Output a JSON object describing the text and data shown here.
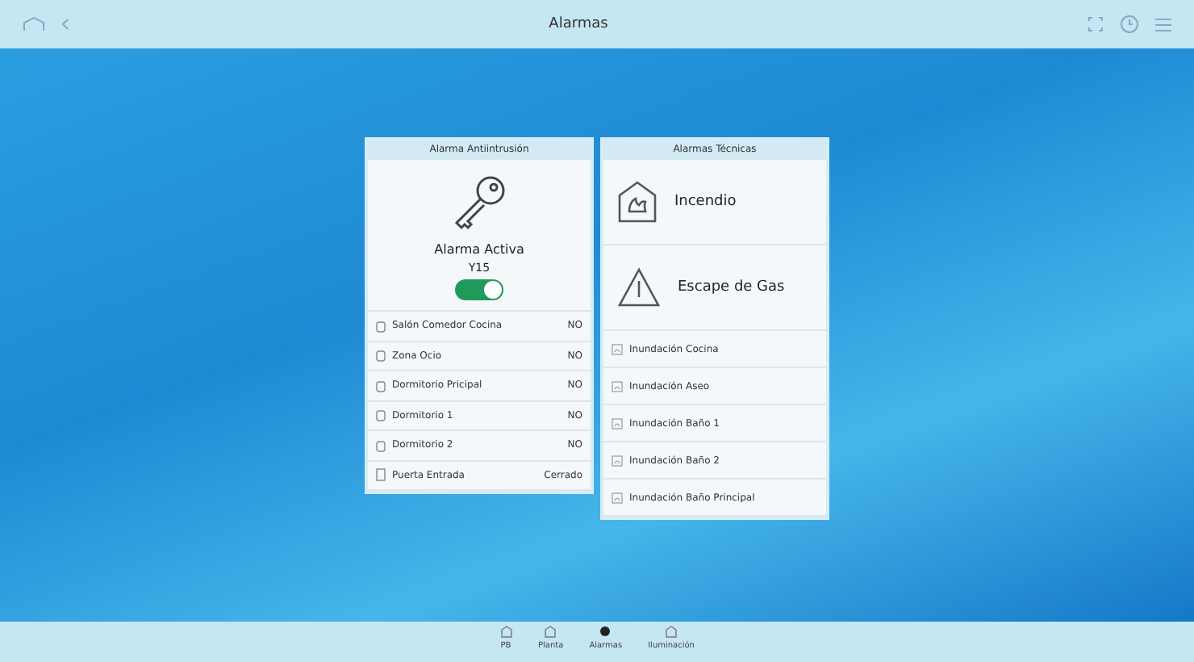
{
  "top_bar": {
    "title": "Alarmas"
  },
  "intrusion_panel": {
    "title": "Alarma Antiintrusión",
    "status": "Alarma Activa",
    "code": "Y15",
    "on": true,
    "zones": [
      {
        "name": "Salón Comedor Cocina",
        "value": "NO",
        "kind": "sensor"
      },
      {
        "name": "Zona Ocio",
        "value": "NO",
        "kind": "sensor"
      },
      {
        "name": "Dormitorio Pricipal",
        "value": "NO",
        "kind": "sensor"
      },
      {
        "name": "Dormitorio 1",
        "value": "NO",
        "kind": "sensor"
      },
      {
        "name": "Dormitorio 2",
        "value": "NO",
        "kind": "sensor"
      },
      {
        "name": "Puerta Entrada",
        "value": "Cerrado",
        "kind": "door"
      }
    ]
  },
  "technical_panel": {
    "title": "Alarmas Técnicas",
    "main_alarms": [
      {
        "label": "Incendio",
        "kind": "fire"
      },
      {
        "label": "Escape de Gas",
        "kind": "gas"
      }
    ],
    "floods": [
      "Inundación Cocina",
      "Inundación Aseo",
      "Inundación Baño 1",
      "Inundación Baño 2",
      "Inundación Baño Principal"
    ]
  },
  "bottom_nav": [
    {
      "label": "PB",
      "selected": false
    },
    {
      "label": "Planta",
      "selected": false
    },
    {
      "label": "Alarmas",
      "selected": true
    },
    {
      "label": "Iluminación",
      "selected": false
    }
  ]
}
